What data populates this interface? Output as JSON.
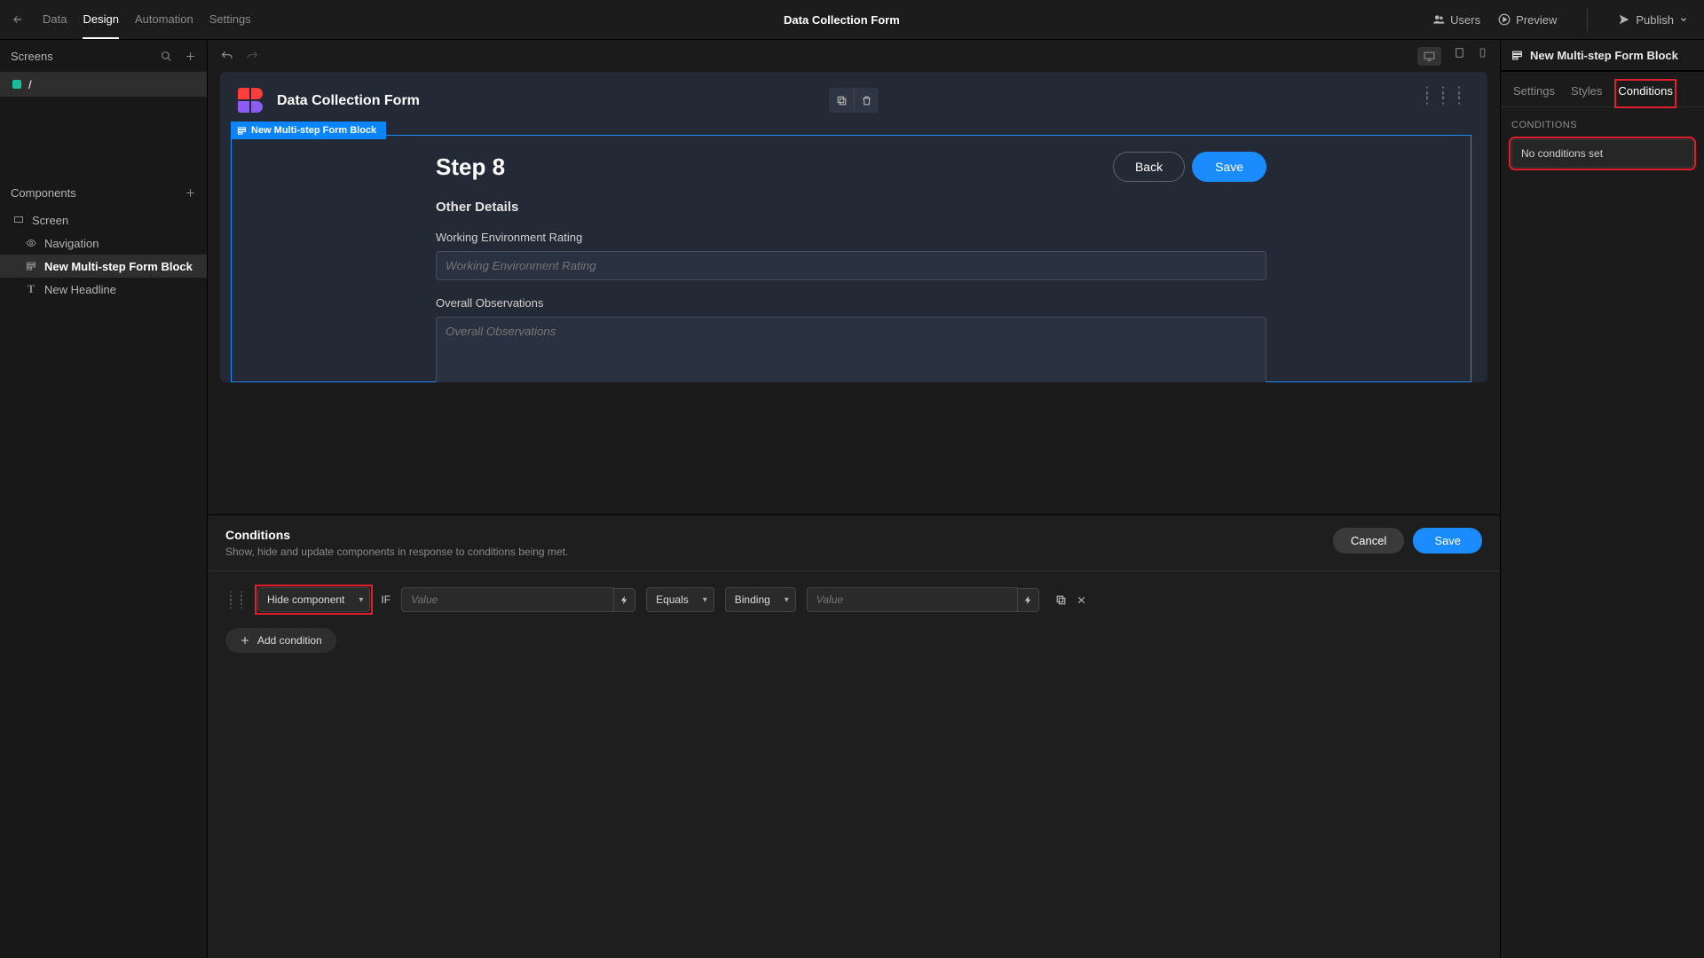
{
  "topnav": {
    "data": "Data",
    "design": "Design",
    "automation": "Automation",
    "settings": "Settings"
  },
  "title": "Data Collection Form",
  "topright": {
    "users": "Users",
    "preview": "Preview",
    "publish": "Publish"
  },
  "left": {
    "screens": "Screens",
    "screen_name": "/",
    "components": "Components",
    "c_screen": "Screen",
    "c_nav": "Navigation",
    "c_form": "New Multi-step Form Block",
    "c_headline": "New Headline"
  },
  "canvas": {
    "card_title": "Data Collection Form",
    "sel_label": "New Multi-step Form Block",
    "step_title": "Step 8",
    "back": "Back",
    "save": "Save",
    "subtitle": "Other Details",
    "f1_label": "Working Environment Rating",
    "f1_ph": "Working Environment Rating",
    "f2_label": "Overall Observations",
    "f2_ph": "Overall Observations"
  },
  "cond": {
    "title": "Conditions",
    "desc": "Show, hide and update components in response to conditions being met.",
    "cancel": "Cancel",
    "save": "Save",
    "action": "Hide component",
    "if": "IF",
    "val_ph": "Value",
    "op": "Equals",
    "bind": "Binding",
    "add": "Add condition"
  },
  "right": {
    "title": "New Multi-step Form Block",
    "t_settings": "Settings",
    "t_styles": "Styles",
    "t_cond": "Conditions",
    "section": "CONDITIONS",
    "empty": "No conditions set"
  }
}
